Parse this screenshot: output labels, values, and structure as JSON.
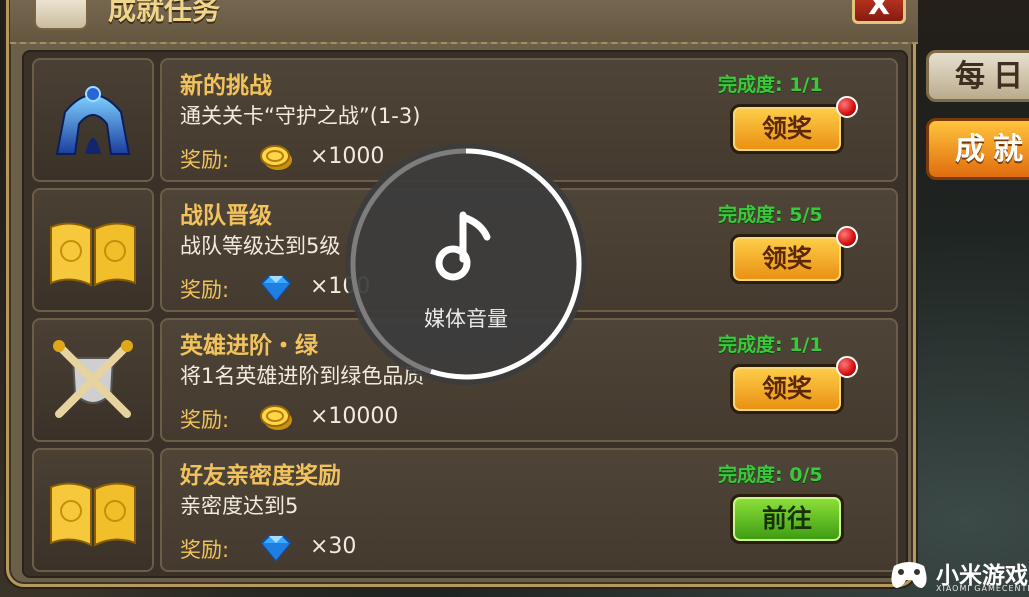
{
  "window": {
    "title": "成就任务",
    "close_label": "X"
  },
  "tabs": {
    "daily": "每日",
    "achievement": "成就"
  },
  "reward_label": "奖励:",
  "tasks": [
    {
      "title": "新的挑战",
      "desc": "通关关卡“守护之战”(1-3)",
      "progress": "完成度: 1/1",
      "reward_icon": "gold-coin-icon",
      "reward_amount": "×1000",
      "button": "领奖",
      "notify": true
    },
    {
      "title": "战队晋级",
      "desc": "战队等级达到5级",
      "progress": "完成度: 5/5",
      "reward_icon": "diamond-icon",
      "reward_amount": "×100",
      "button": "领奖",
      "notify": true
    },
    {
      "title": "英雄进阶・绿",
      "desc": "将1名英雄进阶到绿色品质",
      "progress": "完成度: 1/1",
      "reward_icon": "gold-coin-icon",
      "reward_amount": "×10000",
      "button": "领奖",
      "notify": true
    },
    {
      "title": "好友亲密度奖励",
      "desc": "亲密度达到5",
      "progress": "完成度: 0/5",
      "reward_icon": "diamond-icon",
      "reward_amount": "×30",
      "button": "前往",
      "notify": false
    }
  ],
  "volume_overlay": {
    "label": "媒体音量",
    "level": 0.55
  },
  "watermark": {
    "name": "小米游戏",
    "sub": "XIAOMI GAMECENTER"
  },
  "colors": {
    "title_gold": "#f2c35c",
    "progress_green": "#3bc93b",
    "claim_orange": "#f0a020",
    "go_green": "#5cbf1e",
    "notify_red": "#d40d0d"
  }
}
